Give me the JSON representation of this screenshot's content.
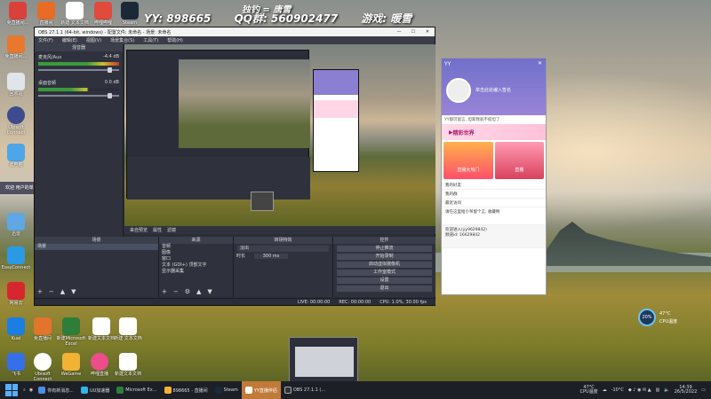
{
  "banner": {
    "yy": "YY: 898665",
    "qq": "QQ群: 560902477",
    "game": "游戏: 暖雪",
    "top": "独钓 = 唐雪"
  },
  "desktop_icons": [
    {
      "label": "免直播间..."
    },
    {
      "label": "Steam"
    },
    {
      "label": "YY"
    },
    {
      "label": "哔哩哔哩"
    },
    {
      "label": "回收站"
    },
    {
      "label": "此电脑"
    },
    {
      "label": "网易云"
    },
    {
      "label": "迅雷"
    },
    {
      "label": "EasyConnect"
    },
    {
      "label": "直播间"
    },
    {
      "label": "Kuai"
    },
    {
      "label": "免直播间"
    },
    {
      "label": "新建Microsoft Excel"
    },
    {
      "label": "新建 文本文档"
    },
    {
      "label": "飞书"
    },
    {
      "label": "Ubisoft Connect"
    },
    {
      "label": "WeGame"
    },
    {
      "label": "哔哩直播"
    },
    {
      "label": "新建文本文档"
    }
  ],
  "side_toast": "欢迎 用户的单级人92进入直播间",
  "obs": {
    "title": "OBS 27.1.1 (64-bit, windows) - 配置文件: 未命名 - 场景: 未命名",
    "menus": [
      "文件(F)",
      "编辑(E)",
      "视图(V)",
      "场景集合(S)",
      "工具(T)",
      "帮助(H)"
    ],
    "mixer_title": "混音器",
    "mixer_channels": [
      {
        "name": "麦克风/Aux",
        "db": "-4.4 dB"
      },
      {
        "name": "桌面音频",
        "db": "0.0 dB"
      }
    ],
    "preview_footer": [
      "来自预览",
      "属性",
      "滤镜"
    ],
    "scenes_title": "场景",
    "scenes": [
      "场景"
    ],
    "sources_title": "来源",
    "sources": [
      "音频",
      "图像",
      "窗口",
      "文本 (GDI+) 顶部文字",
      "显示器采集"
    ],
    "transitions_title": "转场特效",
    "transition_type": "淡出",
    "duration_label": "时长",
    "duration_value": "300 ms",
    "controls_title": "控件",
    "controls": [
      "停止推流",
      "开始录制",
      "启动虚拟摄像机",
      "工作室模式",
      "设置",
      "退出"
    ],
    "status": [
      "LIVE: 00:00:00",
      "REC: 00:00:00",
      "CPU: 1.0%, 30.00 fps"
    ]
  },
  "yy": {
    "title": "YY",
    "profile": "单击此处编入签名",
    "notice": "YY都可留言, 坦家我就不提坦了",
    "banner_text": "精彩世界",
    "tags": [
      "直播大热门",
      "直播"
    ],
    "list": [
      "我的好友",
      "我的群",
      "最近访问"
    ],
    "message": "请在这里给小爷留个言, 收藏哟",
    "channel": "欢迎进入(yy9629842)",
    "channel_id": "频道id: 16629842"
  },
  "taskbar": {
    "items": [
      {
        "label": "你有新消息...",
        "active": false
      },
      {
        "label": "UU加速器",
        "active": false
      },
      {
        "label": "Microsoft Ex...",
        "active": false
      },
      {
        "label": "898665 - 直播间",
        "active": false
      },
      {
        "label": "Steam",
        "active": false
      },
      {
        "label": "YY直播伴侣",
        "active": true
      },
      {
        "label": "OBS 27.1.1 (...",
        "active": false
      }
    ],
    "temp": "47°C",
    "temp_label": "CPU温度",
    "weather": "-10°C",
    "time": "14:39",
    "date": "26/5/2022"
  },
  "cpu_widget": {
    "percent": "20%",
    "label": "CPU温度",
    "temp": "47°C"
  }
}
